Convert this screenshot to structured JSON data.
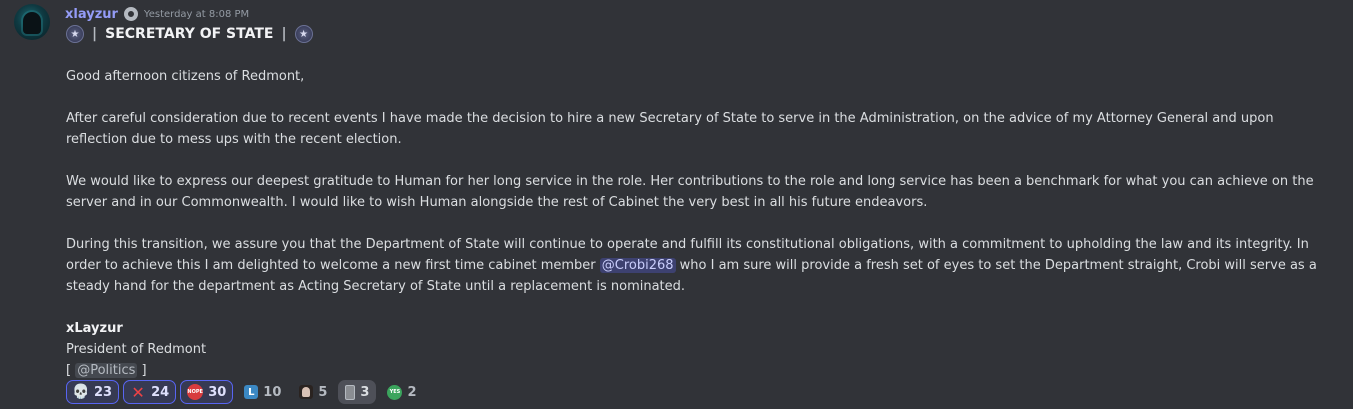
{
  "author": {
    "username": "xlayzur",
    "timestamp": "Yesterday at 8:08 PM"
  },
  "title": {
    "text": "SECRETARY OF STATE",
    "pipe": "|"
  },
  "body": {
    "greeting": "Good afternoon citizens of Redmont,",
    "p1": "After careful consideration due to recent events I have made the decision to hire a new Secretary of State to serve in the Administration, on the advice of my Attorney General and upon reflection due to mess ups with the recent election.",
    "p2": "We would like to express our deepest gratitude to Human for her long service in the role. Her contributions to the role and long service has been a benchmark for what you can achieve on the server and in our Commonwealth. I would like to wish Human alongside the rest of Cabinet the very best in all his future endeavors.",
    "p3_before": "During this transition, we assure you that the Department of State will continue to operate and fulfill its constitutional obligations, with a commitment to upholding the law and its integrity. In order to achieve this I am delighted to welcome a new first time cabinet member ",
    "p3_mention": "@Crobi268",
    "p3_after": " who I am sure will provide a fresh set of eyes to set the Department straight, Crobi will serve as a steady hand for the department as Acting Secretary of State until a replacement is nominated."
  },
  "signature": {
    "name": "xLayzur",
    "role": "President of Redmont",
    "bracket_open": "[",
    "role_mention": "@Politics",
    "bracket_close": "]"
  },
  "reactions": [
    {
      "icon": "skull-icon",
      "count": "23"
    },
    {
      "icon": "x-mark-icon",
      "count": "24"
    },
    {
      "icon": "nope-icon",
      "count": "30"
    },
    {
      "icon": "letter-l-icon",
      "count": "10"
    },
    {
      "icon": "face-icon",
      "count": "5"
    },
    {
      "icon": "phone-icon",
      "count": "3"
    },
    {
      "icon": "yes-icon",
      "count": "2"
    }
  ],
  "icon_text": {
    "skull": "💀",
    "cross": "✕",
    "nope": "NOPE",
    "letter_l": "L",
    "yes": "YES",
    "star": "★"
  }
}
